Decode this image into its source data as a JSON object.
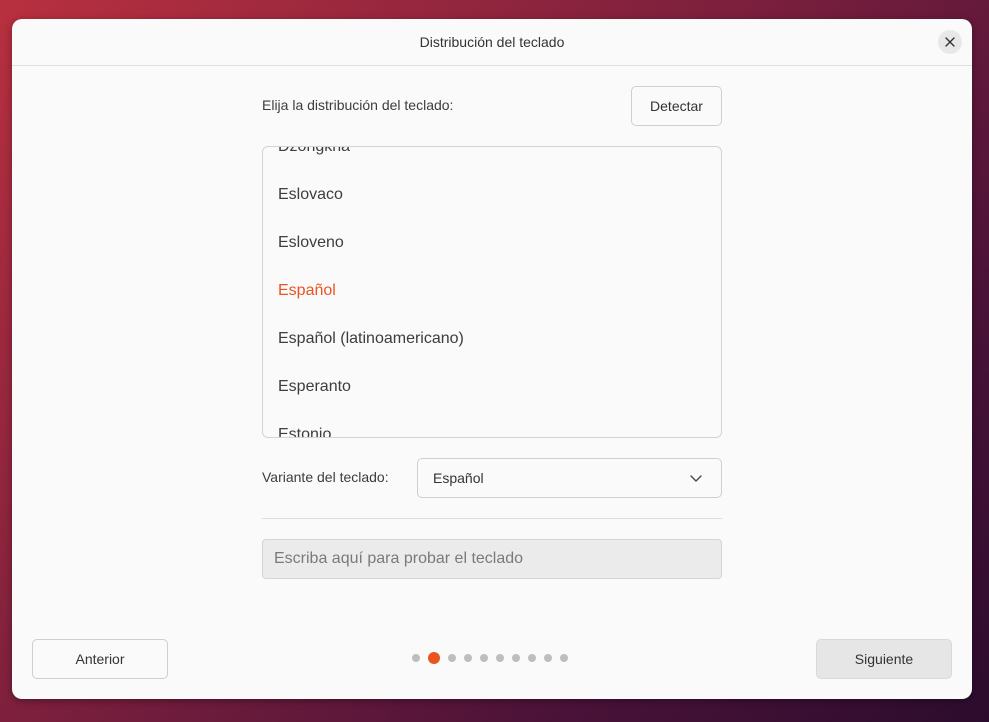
{
  "window": {
    "title": "Distribución del teclado"
  },
  "layout_prompt": "Elija la distribución del teclado:",
  "detect_button": "Detectar",
  "layouts": [
    {
      "label": "Dzongkha",
      "selected": false
    },
    {
      "label": "Eslovaco",
      "selected": false
    },
    {
      "label": "Esloveno",
      "selected": false
    },
    {
      "label": "Español",
      "selected": true
    },
    {
      "label": "Español (latinoamericano)",
      "selected": false
    },
    {
      "label": "Esperanto",
      "selected": false
    },
    {
      "label": "Estonio",
      "selected": false
    }
  ],
  "variant": {
    "label": "Variante del teclado:",
    "value": "Español"
  },
  "test_input": {
    "placeholder": "Escriba aquí para probar el teclado",
    "value": ""
  },
  "footer": {
    "back_button": "Anterior",
    "next_button": "Siguiente",
    "step_total": 10,
    "step_current": 2
  },
  "colors": {
    "accent": "#e95420"
  },
  "icons": {
    "close": "close-icon",
    "chevron": "chevron-down-icon"
  }
}
